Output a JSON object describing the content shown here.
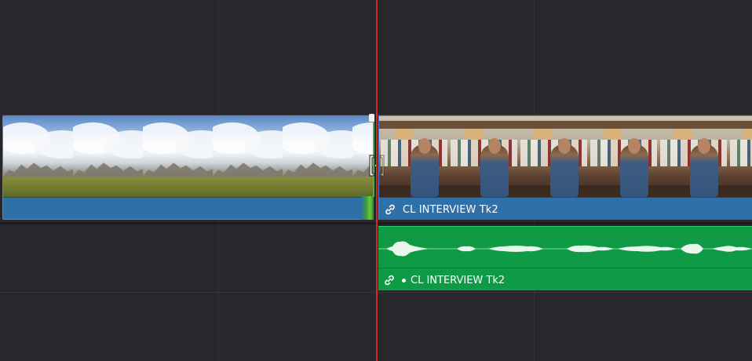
{
  "timeline": {
    "video_track": {
      "clip_landscape": {
        "kind": "video",
        "thumbnail": "landscape-clouds-mountains"
      },
      "clip_interview": {
        "kind": "video",
        "name": "CL INTERVIEW Tk2",
        "linked": true,
        "thumbnail": "interview-shop-man"
      }
    },
    "audio_track": {
      "clip_interview_audio": {
        "kind": "audio",
        "name": "CL INTERVIEW Tk2",
        "linked": true
      }
    },
    "playhead": {
      "color": "#d22a22"
    }
  },
  "colors": {
    "background": "#28272c",
    "video_clip": "#2f70a8",
    "audio_clip": "#0f9a45",
    "transition_edge": "#44b14a",
    "playhead": "#d22a22"
  }
}
